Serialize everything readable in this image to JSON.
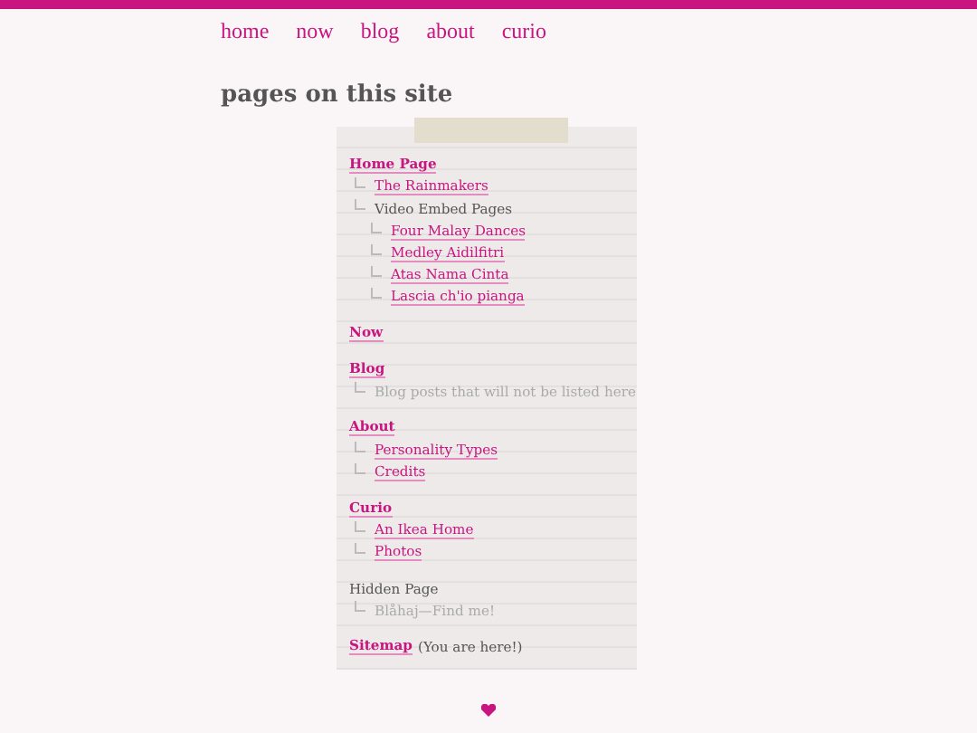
{
  "nav": [
    {
      "label": "home"
    },
    {
      "label": "now"
    },
    {
      "label": "blog"
    },
    {
      "label": "about"
    },
    {
      "label": "curio"
    }
  ],
  "heading": "pages on this site",
  "sections": [
    {
      "title": "Home Page",
      "kind": "link",
      "children": [
        {
          "label": "The Rainmakers",
          "kind": "link"
        },
        {
          "label": "Video Embed Pages",
          "kind": "plain",
          "children": [
            {
              "label": "Four Malay Dances",
              "kind": "link"
            },
            {
              "label": "Medley Aidilfitri",
              "kind": "link"
            },
            {
              "label": "Atas Nama Cinta",
              "kind": "link"
            },
            {
              "label": "Lascia ch'io pianga",
              "kind": "link"
            }
          ]
        }
      ]
    },
    {
      "title": "Now",
      "kind": "link"
    },
    {
      "title": "Blog",
      "kind": "link",
      "children": [
        {
          "label": "Blog posts that will not be listed here",
          "kind": "muted"
        }
      ]
    },
    {
      "title": "About",
      "kind": "link",
      "children": [
        {
          "label": "Personality Types",
          "kind": "link"
        },
        {
          "label": "Credits",
          "kind": "link"
        }
      ]
    },
    {
      "title": "Curio",
      "kind": "link",
      "children": [
        {
          "label": "An Ikea Home",
          "kind": "link"
        },
        {
          "label": "Photos",
          "kind": "link"
        }
      ]
    },
    {
      "title": "Hidden Page",
      "kind": "plain",
      "children": [
        {
          "label": "Blåhaj—Find me!",
          "kind": "muted"
        }
      ]
    },
    {
      "title": "Sitemap",
      "kind": "link",
      "note": "(You are here!)"
    }
  ]
}
